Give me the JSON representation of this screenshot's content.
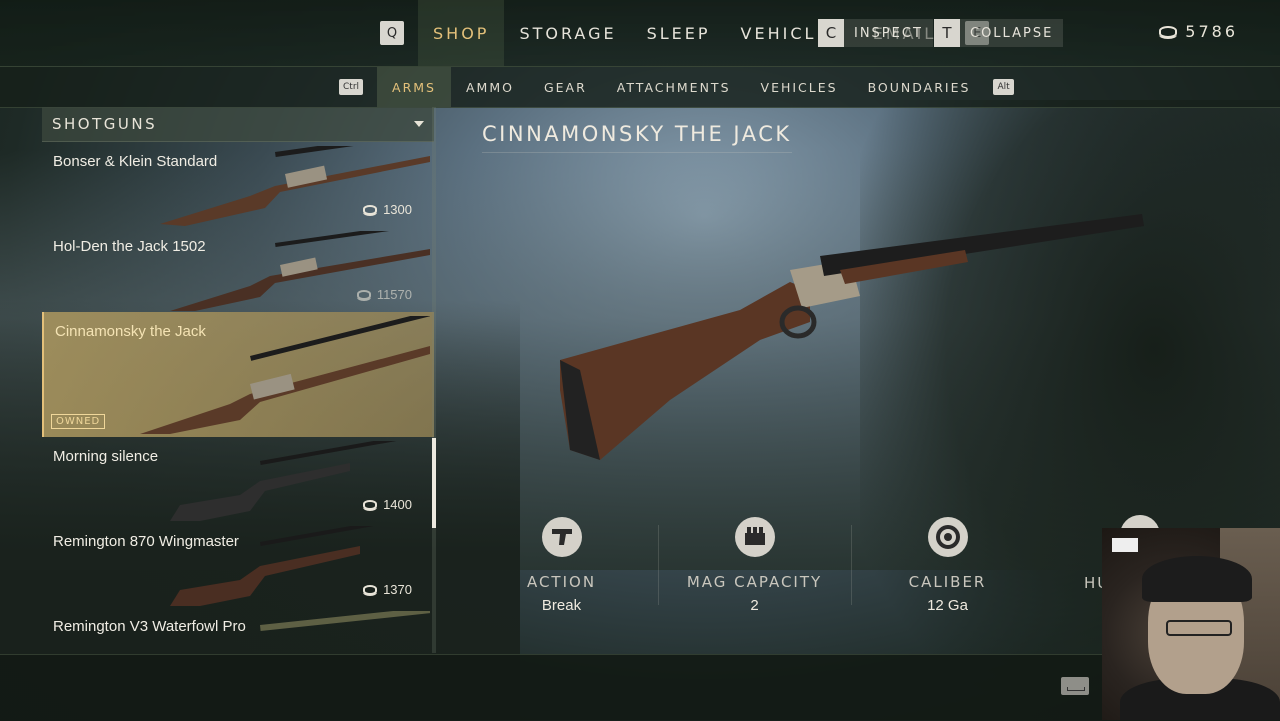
{
  "top_nav": {
    "left_key": "Q",
    "right_key": "E",
    "tabs": [
      {
        "label": "SHOP",
        "active": true
      },
      {
        "label": "STORAGE",
        "active": false
      },
      {
        "label": "SLEEP",
        "active": false
      },
      {
        "label": "VEHICLES",
        "active": false
      },
      {
        "label": "EMAIL",
        "active": false
      }
    ],
    "currency_icon": "coins-icon",
    "currency_amount": "5786"
  },
  "sub_nav": {
    "left_key": "Ctrl",
    "right_key": "Alt",
    "tabs": [
      {
        "label": "ARMS",
        "active": true
      },
      {
        "label": "AMMO",
        "active": false
      },
      {
        "label": "GEAR",
        "active": false
      },
      {
        "label": "ATTACHMENTS",
        "active": false
      },
      {
        "label": "VEHICLES",
        "active": false
      },
      {
        "label": "BOUNDARIES",
        "active": false
      }
    ]
  },
  "weapon_list": {
    "category": "SHOTGUNS",
    "items": [
      {
        "name": "Bonser & Klein Standard",
        "price": "1300",
        "selected": false,
        "owned": false
      },
      {
        "name": "Hol-Den the Jack 1502",
        "price": "11570",
        "selected": false,
        "owned": false
      },
      {
        "name": "Cinnamonsky the Jack",
        "price": "",
        "selected": true,
        "owned": true,
        "owned_label": "OWNED"
      },
      {
        "name": "Morning silence",
        "price": "1400",
        "selected": false,
        "owned": false
      },
      {
        "name": "Remington 870 Wingmaster",
        "price": "1370",
        "selected": false,
        "owned": false
      },
      {
        "name": "Remington V3 Waterfowl Pro",
        "price": "",
        "selected": false,
        "owned": false
      }
    ]
  },
  "detail": {
    "title": "CINNAMONSKY THE JACK",
    "stats": [
      {
        "icon": "trigger-icon",
        "label": "ACTION",
        "value": "Break"
      },
      {
        "icon": "ammo-box-icon",
        "label": "MAG CAPACITY",
        "value": "2"
      },
      {
        "icon": "caliber-icon",
        "label": "CALIBER",
        "value": "12 Ga"
      }
    ],
    "partial_stat_label": "HU"
  },
  "bottom_bar": {
    "inspect": {
      "key": "C",
      "label": "INSPECT"
    },
    "collapse": {
      "key": "T",
      "label": "COLLAPSE"
    }
  },
  "colors": {
    "accent_gold": "#e3c07a",
    "selected_bg": "#aa965f"
  }
}
